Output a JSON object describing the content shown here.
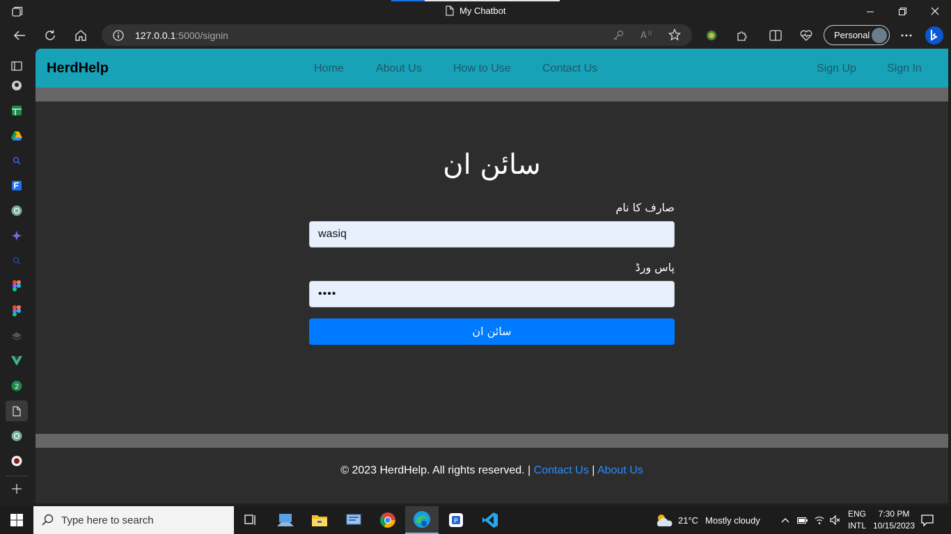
{
  "window": {
    "title": "My Chatbot"
  },
  "browser": {
    "url_host": "127.0.0.1",
    "url_rest": ":5000/signin",
    "profile_label": "Personal"
  },
  "site": {
    "brand": "HerdHelp",
    "nav": {
      "home": "Home",
      "about": "About Us",
      "how_to_use": "How to Use",
      "contact": "Contact Us",
      "sign_up": "Sign Up",
      "sign_in": "Sign In"
    }
  },
  "signin": {
    "heading": "سائن ان",
    "username_label": "صارف کا نام",
    "username_value": "wasiq",
    "password_label": "پاس ورڈ",
    "password_value": "••••",
    "submit_label": "سائن ان"
  },
  "footer": {
    "copyright": "© 2023 HerdHelp. All rights reserved. |",
    "contact_link": "Contact Us",
    "separator": "|",
    "about_link": "About Us"
  },
  "taskbar": {
    "search_placeholder": "Type here to search",
    "weather_temp": "21°C",
    "weather_desc": "Mostly cloudy",
    "lang_top": "ENG",
    "lang_bottom": "INTL",
    "time": "7:30 PM",
    "date": "10/15/2023"
  },
  "colors": {
    "navbar": "#17a2b8",
    "submit": "#007bff",
    "link": "#2b8cff"
  }
}
